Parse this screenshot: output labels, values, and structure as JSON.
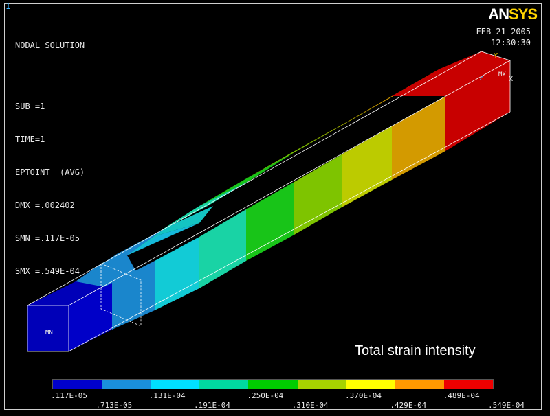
{
  "window_number": "1",
  "info": {
    "title": "NODAL SOLUTION",
    "sub": "SUB =1",
    "time": "TIME=1",
    "item": "EPTOINT  (AVG)",
    "dmx": "DMX =.002402",
    "smn": "SMN =.117E-05",
    "smx": "SMX =.549E-04"
  },
  "logo": {
    "part1": "AN",
    "part2": "SYS"
  },
  "date": "FEB 21 2005",
  "time_of_day": "12:30:30",
  "min_marker": "MN",
  "max_marker": "MX",
  "triad": {
    "y": "Y",
    "z": "Z",
    "x": "X"
  },
  "caption": "Total strain intensity",
  "legend": {
    "colors": [
      "#0000cc",
      "#1a8fdc",
      "#00e0ff",
      "#00d9a0",
      "#00cc00",
      "#a6d300",
      "#ffff00",
      "#ff9900",
      "#ee0000"
    ],
    "labels_bottom": [
      ".117E-05",
      ".131E-04",
      ".250E-04",
      ".370E-04",
      ".489E-04"
    ],
    "labels_top": [
      ".713E-05",
      ".191E-04",
      ".310E-04",
      ".429E-04",
      ".549E-04"
    ]
  }
}
